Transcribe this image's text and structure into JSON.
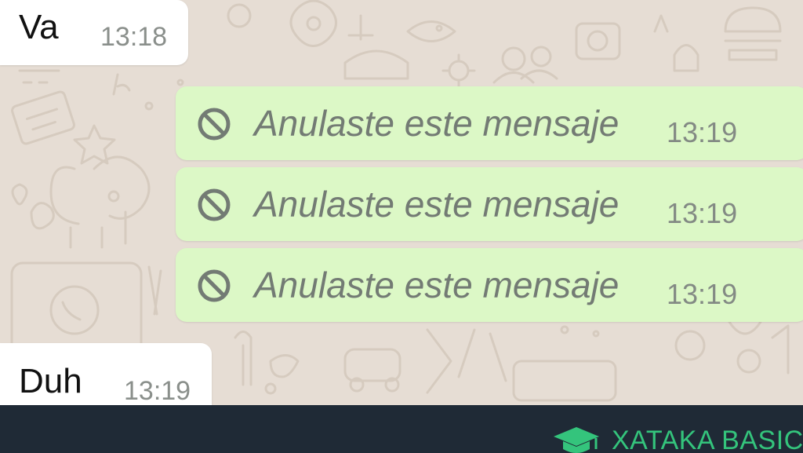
{
  "chat": {
    "messages": [
      {
        "direction": "incoming",
        "text": "Va",
        "time": "13:18"
      },
      {
        "direction": "outgoing",
        "text": "Anulaste este mensaje",
        "time": "13:19",
        "deleted": true,
        "icon": "block-icon"
      },
      {
        "direction": "outgoing",
        "text": "Anulaste este mensaje",
        "time": "13:19",
        "deleted": true,
        "icon": "block-icon"
      },
      {
        "direction": "outgoing",
        "text": "Anulaste este mensaje",
        "time": "13:19",
        "deleted": true,
        "icon": "block-icon"
      },
      {
        "direction": "incoming",
        "text": "Duh",
        "time": "13:19"
      }
    ]
  },
  "footer": {
    "brand": "XATAKA BASIC",
    "icon": "graduation-cap-icon"
  },
  "colors": {
    "wallpaper": "#e6ddd4",
    "incoming_bubble": "#ffffff",
    "outgoing_bubble": "#dcf8c6",
    "deleted_text": "#737b74",
    "footer_background": "#1f2a36",
    "brand_accent": "#34c47c"
  }
}
